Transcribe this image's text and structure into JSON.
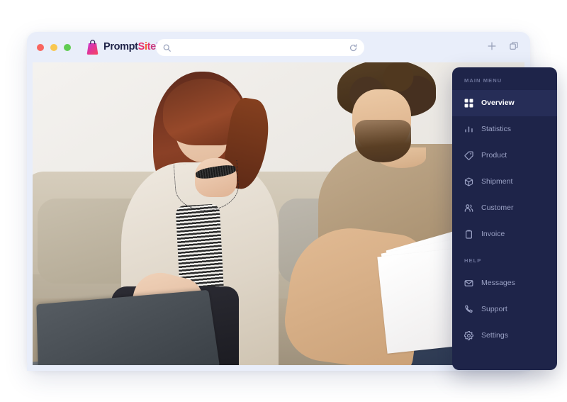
{
  "brand": {
    "icon": "shopping-bag-icon",
    "name_parts": [
      {
        "text": "Prompt",
        "color": "#1f2348"
      },
      {
        "text": "S",
        "color": "#e8316f"
      },
      {
        "text": "i",
        "color": "#f2622b"
      },
      {
        "text": "t",
        "color": "#e8316f"
      },
      {
        "text": "e",
        "color": "#c9397f"
      },
      {
        "text": "Z",
        "color": "#7a3ed6"
      }
    ],
    "full_name": "PromptSiteZ"
  },
  "browser": {
    "traffic_lights": [
      "close",
      "minimize",
      "maximize"
    ],
    "address": {
      "value": "",
      "placeholder": "",
      "search_icon": "search-icon",
      "reload_icon": "reload-icon"
    },
    "toolbar": {
      "new_tab_icon": "plus-icon",
      "tabs_icon": "copy-tabs-icon"
    }
  },
  "content": {
    "photo_alt": "Smiling couple sitting on a beige sofa looking at a laptop while the man holds printed documents"
  },
  "sidebar": {
    "sections": [
      {
        "label": "MAIN MENU",
        "items": [
          {
            "label": "Overview",
            "icon": "grid-icon",
            "active": true
          },
          {
            "label": "Statistics",
            "icon": "bar-chart-icon",
            "active": false
          },
          {
            "label": "Product",
            "icon": "tag-icon",
            "active": false
          },
          {
            "label": "Shipment",
            "icon": "box-icon",
            "active": false
          },
          {
            "label": "Customer",
            "icon": "users-icon",
            "active": false
          },
          {
            "label": "Invoice",
            "icon": "clipboard-icon",
            "active": false
          }
        ]
      },
      {
        "label": "HELP",
        "items": [
          {
            "label": "Messages",
            "icon": "envelope-icon",
            "active": false
          },
          {
            "label": "Support",
            "icon": "phone-icon",
            "active": false
          },
          {
            "label": "Settings",
            "icon": "gear-icon",
            "active": false
          }
        ]
      }
    ]
  },
  "colors": {
    "sidebar_bg": "#1e2449",
    "sidebar_active_bg": "#262d57",
    "browser_chrome": "#e9eefa",
    "accent_pink": "#e8316f",
    "accent_purple": "#7a3ed6",
    "page_bg": "#ffffff"
  }
}
